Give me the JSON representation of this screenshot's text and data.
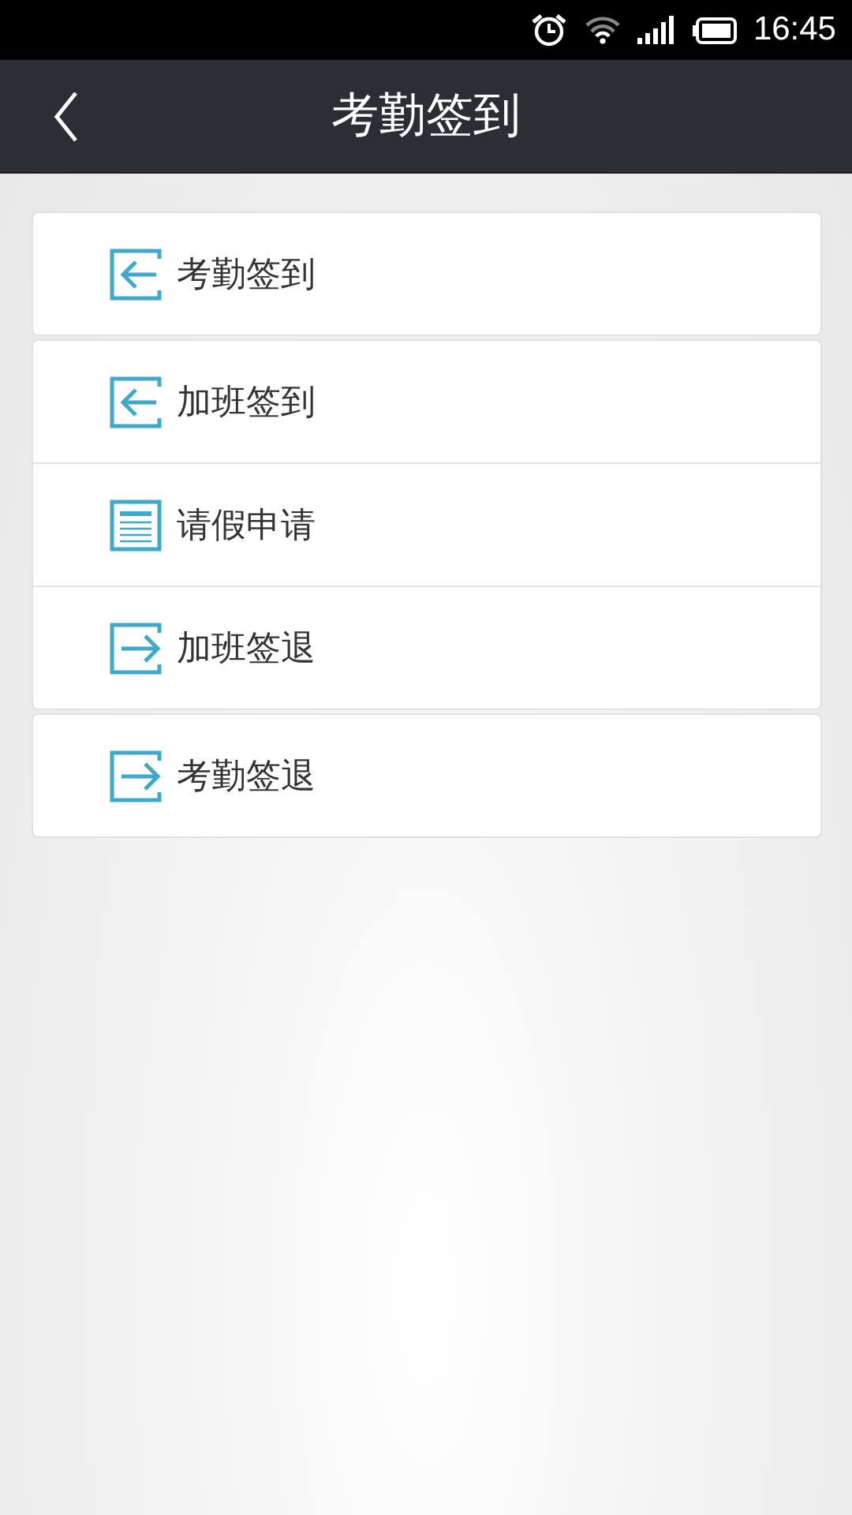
{
  "status_bar": {
    "time": "16:45"
  },
  "header": {
    "title": "考勤签到"
  },
  "groups": [
    {
      "items": [
        {
          "kind": "sign-in",
          "label": "考勤签到"
        }
      ]
    },
    {
      "items": [
        {
          "kind": "sign-in",
          "label": "加班签到"
        },
        {
          "kind": "form",
          "label": "请假申请"
        },
        {
          "kind": "sign-out",
          "label": "加班签退"
        }
      ]
    },
    {
      "items": [
        {
          "kind": "sign-out",
          "label": "考勤签退"
        }
      ]
    }
  ]
}
